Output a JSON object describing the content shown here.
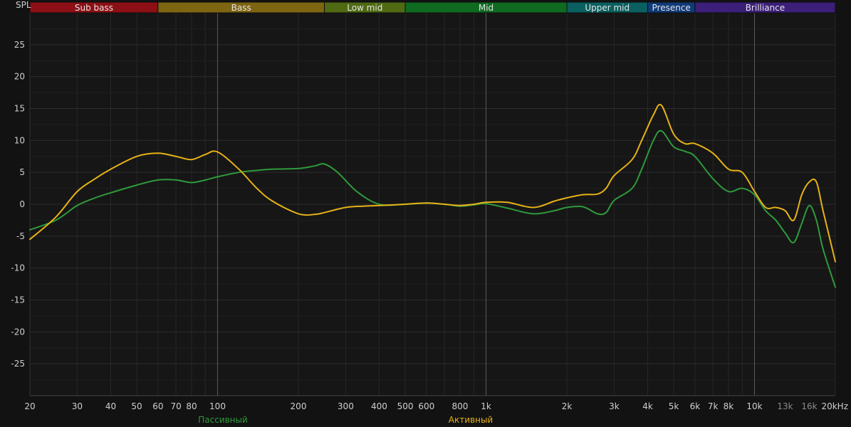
{
  "chart_data": {
    "type": "line",
    "ylabel": "SPL",
    "xunit": "kHz",
    "x_scale": "log",
    "xlim": [
      20,
      20000
    ],
    "ylim": [
      -30,
      30
    ],
    "grid": true,
    "legend_position": "bottom",
    "y_ticks": [
      25,
      20,
      15,
      10,
      5,
      0,
      -5,
      -10,
      -15,
      -20,
      -25
    ],
    "x_ticks": [
      {
        "value": 20,
        "label": "20",
        "dim": false
      },
      {
        "value": 30,
        "label": "30",
        "dim": false
      },
      {
        "value": 40,
        "label": "40",
        "dim": false
      },
      {
        "value": 50,
        "label": "50",
        "dim": false
      },
      {
        "value": 60,
        "label": "60",
        "dim": false
      },
      {
        "value": 70,
        "label": "70",
        "dim": false
      },
      {
        "value": 80,
        "label": "80",
        "dim": false
      },
      {
        "value": 100,
        "label": "100",
        "dim": false
      },
      {
        "value": 200,
        "label": "200",
        "dim": false
      },
      {
        "value": 300,
        "label": "300",
        "dim": false
      },
      {
        "value": 400,
        "label": "400",
        "dim": false
      },
      {
        "value": 500,
        "label": "500",
        "dim": false
      },
      {
        "value": 600,
        "label": "600",
        "dim": false
      },
      {
        "value": 800,
        "label": "800",
        "dim": false
      },
      {
        "value": 1000,
        "label": "1k",
        "dim": false
      },
      {
        "value": 2000,
        "label": "2k",
        "dim": false
      },
      {
        "value": 3000,
        "label": "3k",
        "dim": false
      },
      {
        "value": 4000,
        "label": "4k",
        "dim": false
      },
      {
        "value": 5000,
        "label": "5k",
        "dim": false
      },
      {
        "value": 6000,
        "label": "6k",
        "dim": false
      },
      {
        "value": 7000,
        "label": "7k",
        "dim": false
      },
      {
        "value": 8000,
        "label": "8k",
        "dim": false
      },
      {
        "value": 10000,
        "label": "10k",
        "dim": false
      },
      {
        "value": 13000,
        "label": "13k",
        "dim": true
      },
      {
        "value": 16000,
        "label": "16k",
        "dim": true
      },
      {
        "value": 20000,
        "label": "20kHz",
        "dim": false
      }
    ],
    "major_x_lines": [
      100,
      1000,
      10000
    ],
    "bands": [
      {
        "label": "Sub bass",
        "from": 20,
        "to": 60,
        "color": "#8b0f14"
      },
      {
        "label": "Bass",
        "from": 60,
        "to": 250,
        "color": "#7d6512"
      },
      {
        "label": "Low mid",
        "from": 250,
        "to": 500,
        "color": "#4f6a12"
      },
      {
        "label": "Mid",
        "from": 500,
        "to": 2000,
        "color": "#0f6a22"
      },
      {
        "label": "Upper mid",
        "from": 2000,
        "to": 4000,
        "color": "#0b5f5f"
      },
      {
        "label": "Presence",
        "from": 4000,
        "to": 6000,
        "color": "#103a78"
      },
      {
        "label": "Brilliance",
        "from": 6000,
        "to": 20000,
        "color": "#3b1f78"
      }
    ],
    "series": [
      {
        "name": "Пассивный",
        "color": "#2f9a3c",
        "points": [
          [
            20,
            -4.0
          ],
          [
            25,
            -2.5
          ],
          [
            30,
            -0.2
          ],
          [
            35,
            1.0
          ],
          [
            40,
            1.8
          ],
          [
            50,
            3.0
          ],
          [
            60,
            3.8
          ],
          [
            70,
            3.8
          ],
          [
            80,
            3.4
          ],
          [
            90,
            3.8
          ],
          [
            100,
            4.3
          ],
          [
            120,
            5.0
          ],
          [
            140,
            5.3
          ],
          [
            160,
            5.5
          ],
          [
            200,
            5.6
          ],
          [
            230,
            6.0
          ],
          [
            250,
            6.3
          ],
          [
            280,
            5.0
          ],
          [
            330,
            2.0
          ],
          [
            400,
            0.0
          ],
          [
            500,
            0.0
          ],
          [
            600,
            0.2
          ],
          [
            700,
            0.0
          ],
          [
            800,
            -0.3
          ],
          [
            900,
            -0.1
          ],
          [
            1000,
            0.1
          ],
          [
            1200,
            -0.6
          ],
          [
            1500,
            -1.5
          ],
          [
            1800,
            -1.0
          ],
          [
            2000,
            -0.5
          ],
          [
            2300,
            -0.4
          ],
          [
            2600,
            -1.5
          ],
          [
            2800,
            -1.3
          ],
          [
            3000,
            0.6
          ],
          [
            3500,
            2.5
          ],
          [
            3800,
            5.5
          ],
          [
            4200,
            10.0
          ],
          [
            4500,
            11.5
          ],
          [
            5000,
            9.0
          ],
          [
            5500,
            8.3
          ],
          [
            6000,
            7.5
          ],
          [
            7000,
            4.0
          ],
          [
            8000,
            2.0
          ],
          [
            9000,
            2.5
          ],
          [
            10000,
            1.5
          ],
          [
            11000,
            -1.0
          ],
          [
            12000,
            -2.5
          ],
          [
            13000,
            -4.5
          ],
          [
            14000,
            -6.0
          ],
          [
            15000,
            -3.0
          ],
          [
            16000,
            -0.2
          ],
          [
            17000,
            -2.5
          ],
          [
            18000,
            -7.0
          ],
          [
            20000,
            -13.0
          ]
        ]
      },
      {
        "name": "Активный",
        "color": "#e6b216",
        "points": [
          [
            20,
            -5.5
          ],
          [
            25,
            -2.0
          ],
          [
            30,
            2.0
          ],
          [
            35,
            4.0
          ],
          [
            40,
            5.5
          ],
          [
            50,
            7.5
          ],
          [
            60,
            8.0
          ],
          [
            70,
            7.5
          ],
          [
            80,
            7.0
          ],
          [
            90,
            7.8
          ],
          [
            100,
            8.2
          ],
          [
            120,
            5.5
          ],
          [
            140,
            2.5
          ],
          [
            160,
            0.5
          ],
          [
            200,
            -1.5
          ],
          [
            230,
            -1.6
          ],
          [
            250,
            -1.3
          ],
          [
            300,
            -0.5
          ],
          [
            350,
            -0.3
          ],
          [
            400,
            -0.2
          ],
          [
            500,
            0.0
          ],
          [
            600,
            0.2
          ],
          [
            700,
            0.0
          ],
          [
            800,
            -0.2
          ],
          [
            900,
            0.0
          ],
          [
            1000,
            0.3
          ],
          [
            1200,
            0.3
          ],
          [
            1500,
            -0.5
          ],
          [
            1800,
            0.5
          ],
          [
            2000,
            1.0
          ],
          [
            2300,
            1.5
          ],
          [
            2600,
            1.6
          ],
          [
            2800,
            2.5
          ],
          [
            3000,
            4.5
          ],
          [
            3500,
            7.0
          ],
          [
            3800,
            10.0
          ],
          [
            4200,
            14.0
          ],
          [
            4500,
            15.5
          ],
          [
            5000,
            11.0
          ],
          [
            5500,
            9.5
          ],
          [
            6000,
            9.5
          ],
          [
            7000,
            8.0
          ],
          [
            8000,
            5.5
          ],
          [
            9000,
            5.0
          ],
          [
            10000,
            2.0
          ],
          [
            11000,
            -0.5
          ],
          [
            12000,
            -0.5
          ],
          [
            13000,
            -1.0
          ],
          [
            14000,
            -2.5
          ],
          [
            15000,
            1.5
          ],
          [
            16000,
            3.5
          ],
          [
            17000,
            3.5
          ],
          [
            18000,
            -1.0
          ],
          [
            20000,
            -9.0
          ]
        ]
      }
    ]
  }
}
